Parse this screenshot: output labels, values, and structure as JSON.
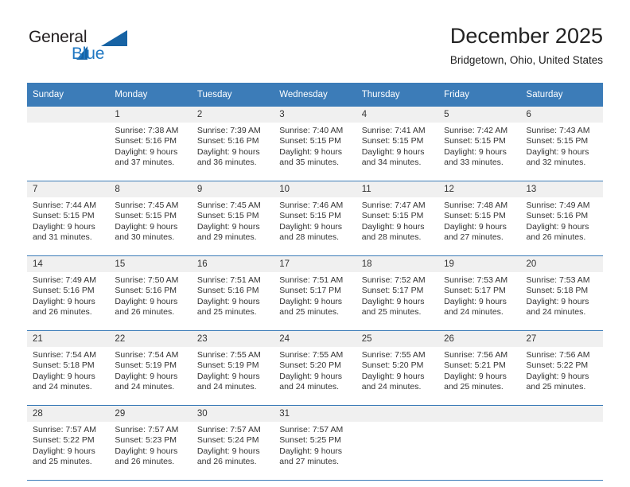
{
  "logo": {
    "word1": "General",
    "word2": "Blue",
    "triangle_icon": "logo-triangle-icon",
    "color_dark": "#231f20",
    "color_blue": "#1f77c2"
  },
  "header": {
    "title": "December 2025",
    "subtitle": "Bridgetown, Ohio, United States"
  },
  "colors": {
    "header_row": "#3c7cb8",
    "daynum_band": "#f0f0f0",
    "text": "#333333"
  },
  "weekday_headers": [
    "Sunday",
    "Monday",
    "Tuesday",
    "Wednesday",
    "Thursday",
    "Friday",
    "Saturday"
  ],
  "weeks": [
    [
      {
        "day": "",
        "lines": []
      },
      {
        "day": "1",
        "lines": [
          "Sunrise: 7:38 AM",
          "Sunset: 5:16 PM",
          "Daylight: 9 hours",
          "and 37 minutes."
        ]
      },
      {
        "day": "2",
        "lines": [
          "Sunrise: 7:39 AM",
          "Sunset: 5:16 PM",
          "Daylight: 9 hours",
          "and 36 minutes."
        ]
      },
      {
        "day": "3",
        "lines": [
          "Sunrise: 7:40 AM",
          "Sunset: 5:15 PM",
          "Daylight: 9 hours",
          "and 35 minutes."
        ]
      },
      {
        "day": "4",
        "lines": [
          "Sunrise: 7:41 AM",
          "Sunset: 5:15 PM",
          "Daylight: 9 hours",
          "and 34 minutes."
        ]
      },
      {
        "day": "5",
        "lines": [
          "Sunrise: 7:42 AM",
          "Sunset: 5:15 PM",
          "Daylight: 9 hours",
          "and 33 minutes."
        ]
      },
      {
        "day": "6",
        "lines": [
          "Sunrise: 7:43 AM",
          "Sunset: 5:15 PM",
          "Daylight: 9 hours",
          "and 32 minutes."
        ]
      }
    ],
    [
      {
        "day": "7",
        "lines": [
          "Sunrise: 7:44 AM",
          "Sunset: 5:15 PM",
          "Daylight: 9 hours",
          "and 31 minutes."
        ]
      },
      {
        "day": "8",
        "lines": [
          "Sunrise: 7:45 AM",
          "Sunset: 5:15 PM",
          "Daylight: 9 hours",
          "and 30 minutes."
        ]
      },
      {
        "day": "9",
        "lines": [
          "Sunrise: 7:45 AM",
          "Sunset: 5:15 PM",
          "Daylight: 9 hours",
          "and 29 minutes."
        ]
      },
      {
        "day": "10",
        "lines": [
          "Sunrise: 7:46 AM",
          "Sunset: 5:15 PM",
          "Daylight: 9 hours",
          "and 28 minutes."
        ]
      },
      {
        "day": "11",
        "lines": [
          "Sunrise: 7:47 AM",
          "Sunset: 5:15 PM",
          "Daylight: 9 hours",
          "and 28 minutes."
        ]
      },
      {
        "day": "12",
        "lines": [
          "Sunrise: 7:48 AM",
          "Sunset: 5:15 PM",
          "Daylight: 9 hours",
          "and 27 minutes."
        ]
      },
      {
        "day": "13",
        "lines": [
          "Sunrise: 7:49 AM",
          "Sunset: 5:16 PM",
          "Daylight: 9 hours",
          "and 26 minutes."
        ]
      }
    ],
    [
      {
        "day": "14",
        "lines": [
          "Sunrise: 7:49 AM",
          "Sunset: 5:16 PM",
          "Daylight: 9 hours",
          "and 26 minutes."
        ]
      },
      {
        "day": "15",
        "lines": [
          "Sunrise: 7:50 AM",
          "Sunset: 5:16 PM",
          "Daylight: 9 hours",
          "and 26 minutes."
        ]
      },
      {
        "day": "16",
        "lines": [
          "Sunrise: 7:51 AM",
          "Sunset: 5:16 PM",
          "Daylight: 9 hours",
          "and 25 minutes."
        ]
      },
      {
        "day": "17",
        "lines": [
          "Sunrise: 7:51 AM",
          "Sunset: 5:17 PM",
          "Daylight: 9 hours",
          "and 25 minutes."
        ]
      },
      {
        "day": "18",
        "lines": [
          "Sunrise: 7:52 AM",
          "Sunset: 5:17 PM",
          "Daylight: 9 hours",
          "and 25 minutes."
        ]
      },
      {
        "day": "19",
        "lines": [
          "Sunrise: 7:53 AM",
          "Sunset: 5:17 PM",
          "Daylight: 9 hours",
          "and 24 minutes."
        ]
      },
      {
        "day": "20",
        "lines": [
          "Sunrise: 7:53 AM",
          "Sunset: 5:18 PM",
          "Daylight: 9 hours",
          "and 24 minutes."
        ]
      }
    ],
    [
      {
        "day": "21",
        "lines": [
          "Sunrise: 7:54 AM",
          "Sunset: 5:18 PM",
          "Daylight: 9 hours",
          "and 24 minutes."
        ]
      },
      {
        "day": "22",
        "lines": [
          "Sunrise: 7:54 AM",
          "Sunset: 5:19 PM",
          "Daylight: 9 hours",
          "and 24 minutes."
        ]
      },
      {
        "day": "23",
        "lines": [
          "Sunrise: 7:55 AM",
          "Sunset: 5:19 PM",
          "Daylight: 9 hours",
          "and 24 minutes."
        ]
      },
      {
        "day": "24",
        "lines": [
          "Sunrise: 7:55 AM",
          "Sunset: 5:20 PM",
          "Daylight: 9 hours",
          "and 24 minutes."
        ]
      },
      {
        "day": "25",
        "lines": [
          "Sunrise: 7:55 AM",
          "Sunset: 5:20 PM",
          "Daylight: 9 hours",
          "and 24 minutes."
        ]
      },
      {
        "day": "26",
        "lines": [
          "Sunrise: 7:56 AM",
          "Sunset: 5:21 PM",
          "Daylight: 9 hours",
          "and 25 minutes."
        ]
      },
      {
        "day": "27",
        "lines": [
          "Sunrise: 7:56 AM",
          "Sunset: 5:22 PM",
          "Daylight: 9 hours",
          "and 25 minutes."
        ]
      }
    ],
    [
      {
        "day": "28",
        "lines": [
          "Sunrise: 7:57 AM",
          "Sunset: 5:22 PM",
          "Daylight: 9 hours",
          "and 25 minutes."
        ]
      },
      {
        "day": "29",
        "lines": [
          "Sunrise: 7:57 AM",
          "Sunset: 5:23 PM",
          "Daylight: 9 hours",
          "and 26 minutes."
        ]
      },
      {
        "day": "30",
        "lines": [
          "Sunrise: 7:57 AM",
          "Sunset: 5:24 PM",
          "Daylight: 9 hours",
          "and 26 minutes."
        ]
      },
      {
        "day": "31",
        "lines": [
          "Sunrise: 7:57 AM",
          "Sunset: 5:25 PM",
          "Daylight: 9 hours",
          "and 27 minutes."
        ]
      },
      {
        "day": "",
        "lines": []
      },
      {
        "day": "",
        "lines": []
      },
      {
        "day": "",
        "lines": []
      }
    ]
  ]
}
